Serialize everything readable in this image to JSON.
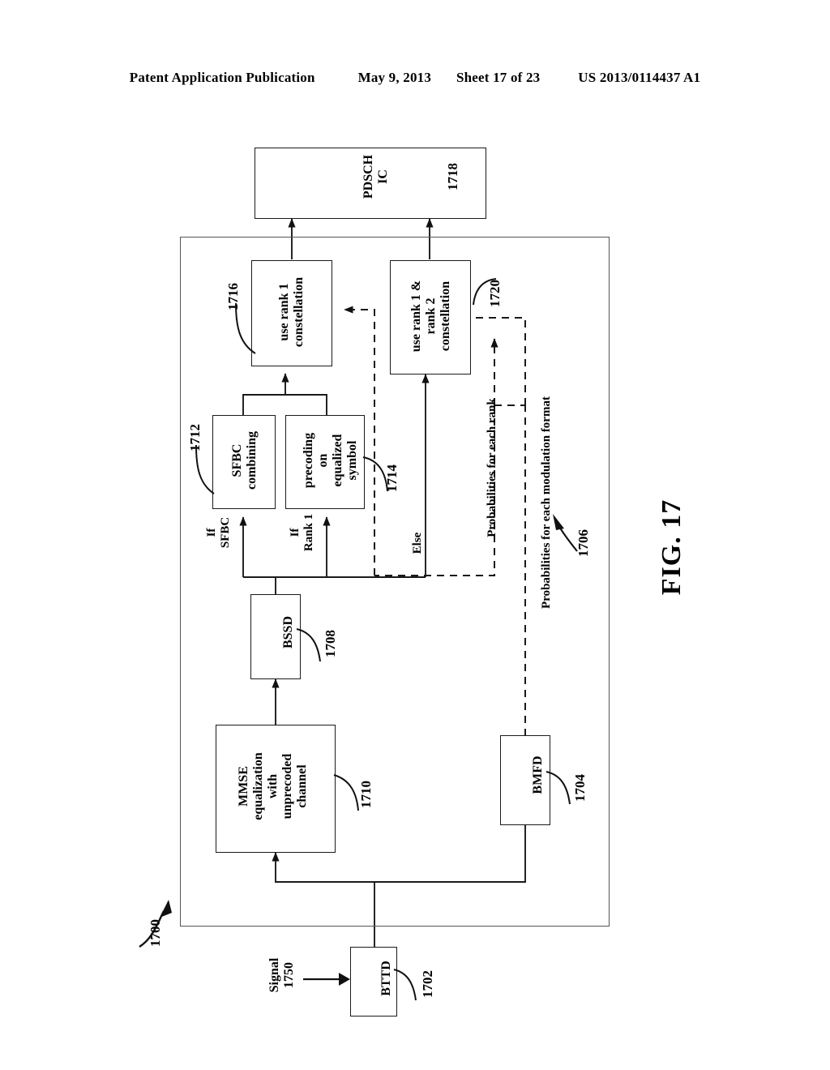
{
  "header": {
    "publication": "Patent Application Publication",
    "date": "May 9, 2013",
    "sheet": "Sheet 17 of 23",
    "docnumber": "US 2013/0114437 A1"
  },
  "figure": {
    "label": "FIG. 17",
    "system_ref": "1700",
    "input": {
      "signal_label": "Signal\n1750"
    },
    "boxes": [
      {
        "id": "pdsch_ic",
        "label": "PDSCH\nIC",
        "ref": "1718"
      },
      {
        "id": "rank1",
        "label": "use rank 1\nconstellation",
        "ref": "1716"
      },
      {
        "id": "rank1rank2",
        "label": "use rank 1 &\nrank 2\nconstellation",
        "ref": "1720"
      },
      {
        "id": "sfbc",
        "label": "SFBC\ncombining",
        "ref": "1712"
      },
      {
        "id": "precoding",
        "label": "precoding\non\nequalized\nsymbol",
        "ref": "1714"
      },
      {
        "id": "bssd",
        "label": "BSSD",
        "ref": "1708"
      },
      {
        "id": "mmse",
        "label": "MMSE\nequalization\nwith\nunprecoded\nchannel",
        "ref": "1710"
      },
      {
        "id": "bmfd",
        "label": "BMFD",
        "ref": "1704"
      },
      {
        "id": "bttd",
        "label": "BTTD",
        "ref": "1702"
      }
    ],
    "edge_labels": [
      {
        "id": "if_sfbc",
        "label": "If\nSFBC"
      },
      {
        "id": "if_rank1",
        "label": "If\nRank 1"
      },
      {
        "id": "else",
        "label": "Else"
      },
      {
        "id": "prob_rank",
        "label": "Probabilities for each rank"
      },
      {
        "id": "prob_mod",
        "label": "Probabilities for each modulation format",
        "ref": "1706"
      }
    ]
  }
}
